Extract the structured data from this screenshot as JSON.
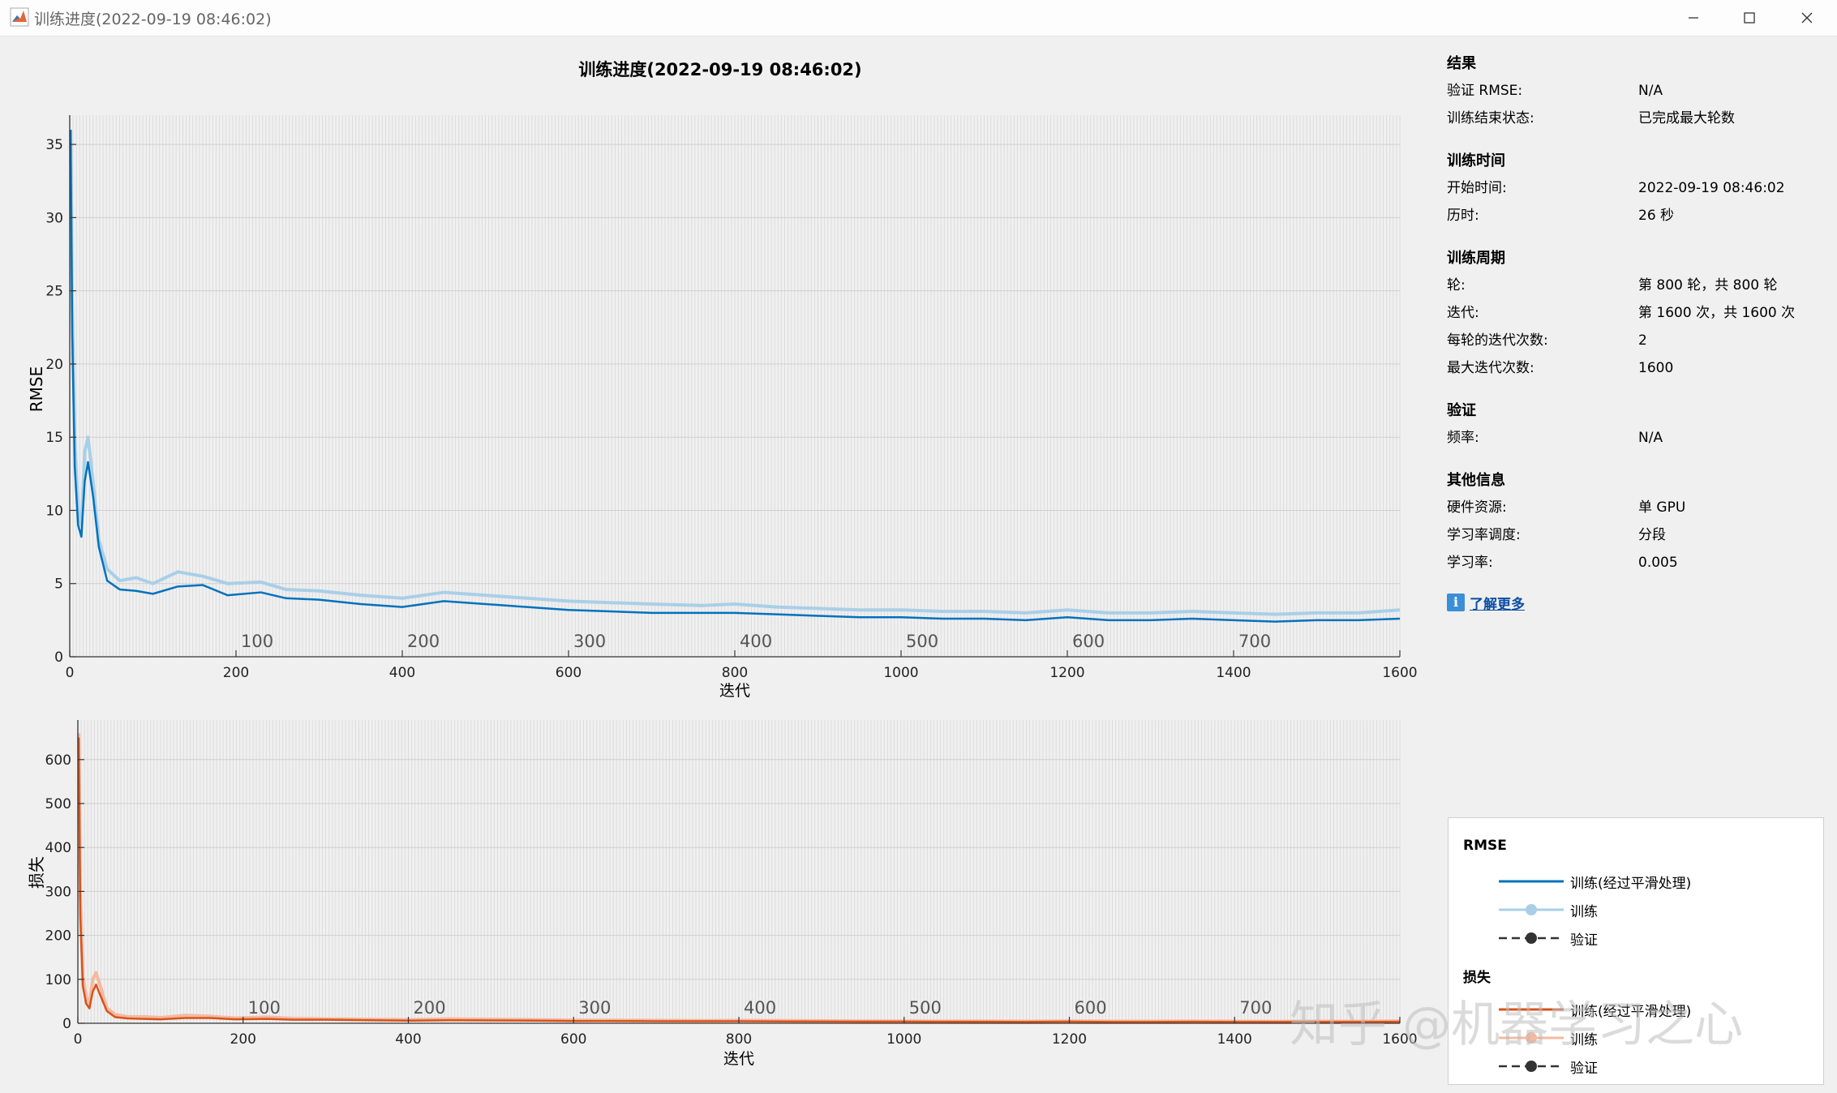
{
  "window": {
    "title": "训练进度(2022-09-19 08:46:02)"
  },
  "figure_title": "训练进度(2022-09-19 08:46:02)",
  "panel": {
    "results": {
      "heading": "结果",
      "rows": [
        {
          "k": "验证 RMSE:",
          "v": "N/A"
        },
        {
          "k": "训练结束状态:",
          "v": "已完成最大轮数"
        }
      ]
    },
    "time": {
      "heading": "训练时间",
      "rows": [
        {
          "k": "开始时间:",
          "v": "2022-09-19 08:46:02"
        },
        {
          "k": "历时:",
          "v": "26 秒"
        }
      ]
    },
    "cycle": {
      "heading": "训练周期",
      "rows": [
        {
          "k": "轮:",
          "v": "第 800 轮，共 800 轮"
        },
        {
          "k": "迭代:",
          "v": "第 1600 次，共 1600 次"
        },
        {
          "k": "每轮的迭代次数:",
          "v": "2"
        },
        {
          "k": "最大迭代次数:",
          "v": "1600"
        }
      ]
    },
    "validation": {
      "heading": "验证",
      "rows": [
        {
          "k": "频率:",
          "v": "N/A"
        }
      ]
    },
    "other": {
      "heading": "其他信息",
      "rows": [
        {
          "k": "硬件资源:",
          "v": "单 GPU"
        },
        {
          "k": "学习率调度:",
          "v": "分段"
        },
        {
          "k": "学习率:",
          "v": "0.005"
        }
      ]
    },
    "learn_more": "了解更多"
  },
  "legend": {
    "rmse_title": "RMSE",
    "rmse_items": [
      "训练(经过平滑处理)",
      "训练",
      "验证"
    ],
    "loss_title": "损失",
    "loss_items": [
      "训练(经过平滑处理)",
      "训练",
      "验证"
    ]
  },
  "colors": {
    "rmse_smoothed": "#0072bd",
    "rmse_raw": "#a9cfe8",
    "loss_smoothed": "#d95319",
    "loss_raw": "#f4b9a0",
    "validation": "#333333"
  },
  "watermark": "知乎 @机器学习之心",
  "chart_data": [
    {
      "type": "line",
      "ylabel": "RMSE",
      "xlabel": "迭代",
      "xlim": [
        0,
        1600
      ],
      "ylim": [
        0,
        37
      ],
      "xticks": [
        0,
        200,
        400,
        600,
        800,
        1000,
        1200,
        1400,
        1600
      ],
      "yticks": [
        0,
        5,
        10,
        15,
        20,
        25,
        30,
        35
      ],
      "epoch_labels": [
        100,
        200,
        300,
        400,
        500,
        600,
        700
      ],
      "grid": true,
      "series": [
        {
          "name": "训练(经过平滑处理)",
          "x": [
            1,
            3,
            6,
            10,
            14,
            18,
            22,
            28,
            35,
            45,
            60,
            80,
            100,
            130,
            160,
            190,
            230,
            260,
            300,
            350,
            400,
            450,
            500,
            550,
            600,
            650,
            700,
            760,
            800,
            850,
            900,
            950,
            1000,
            1050,
            1100,
            1150,
            1200,
            1250,
            1300,
            1350,
            1400,
            1450,
            1500,
            1550,
            1600
          ],
          "y": [
            36,
            22,
            13,
            9,
            8.2,
            12,
            13.3,
            11,
            7.5,
            5.2,
            4.6,
            4.5,
            4.3,
            4.8,
            4.9,
            4.2,
            4.4,
            4.0,
            3.9,
            3.6,
            3.4,
            3.8,
            3.6,
            3.4,
            3.2,
            3.1,
            3.0,
            3.0,
            3.0,
            2.9,
            2.8,
            2.7,
            2.7,
            2.6,
            2.6,
            2.5,
            2.7,
            2.5,
            2.5,
            2.6,
            2.5,
            2.4,
            2.5,
            2.5,
            2.6
          ]
        },
        {
          "name": "训练",
          "x": [
            1,
            3,
            6,
            10,
            14,
            18,
            22,
            28,
            35,
            45,
            60,
            80,
            100,
            130,
            160,
            190,
            230,
            260,
            300,
            350,
            400,
            450,
            500,
            550,
            600,
            650,
            700,
            760,
            800,
            850,
            900,
            950,
            1000,
            1050,
            1100,
            1150,
            1200,
            1250,
            1300,
            1350,
            1400,
            1450,
            1500,
            1550,
            1600
          ],
          "y": [
            36,
            24,
            15,
            10,
            9,
            14,
            15,
            12,
            8,
            6,
            5.2,
            5.4,
            5.0,
            5.8,
            5.5,
            5.0,
            5.1,
            4.6,
            4.5,
            4.2,
            4.0,
            4.4,
            4.2,
            4.0,
            3.8,
            3.7,
            3.6,
            3.5,
            3.6,
            3.4,
            3.3,
            3.2,
            3.2,
            3.1,
            3.1,
            3.0,
            3.2,
            3.0,
            3.0,
            3.1,
            3.0,
            2.9,
            3.0,
            3.0,
            3.2
          ]
        }
      ]
    },
    {
      "type": "line",
      "ylabel": "损失",
      "xlabel": "迭代",
      "xlim": [
        0,
        1600
      ],
      "ylim": [
        0,
        690
      ],
      "xticks": [
        0,
        200,
        400,
        600,
        800,
        1000,
        1200,
        1400,
        1600
      ],
      "yticks": [
        0,
        100,
        200,
        300,
        400,
        500,
        600
      ],
      "epoch_labels": [
        100,
        200,
        300,
        400,
        500,
        600,
        700
      ],
      "grid": true,
      "series": [
        {
          "name": "训练(经过平滑处理)",
          "x": [
            1,
            3,
            6,
            10,
            14,
            18,
            22,
            28,
            35,
            45,
            60,
            80,
            100,
            130,
            160,
            190,
            230,
            260,
            300,
            350,
            400,
            450,
            500,
            550,
            600,
            650,
            700,
            760,
            800,
            850,
            900,
            950,
            1000,
            1050,
            1100,
            1150,
            1200,
            1250,
            1300,
            1350,
            1400,
            1450,
            1500,
            1550,
            1600
          ],
          "y": [
            650,
            240,
            85,
            45,
            34,
            72,
            88,
            60,
            28,
            14,
            11,
            10,
            9,
            12,
            12,
            9,
            10,
            8,
            8,
            7,
            6,
            7,
            6.5,
            6,
            5,
            5,
            4.5,
            4.5,
            4.5,
            4.2,
            4,
            3.7,
            3.7,
            3.4,
            3.4,
            3.1,
            3.6,
            3.1,
            3.1,
            3.4,
            3.1,
            2.9,
            3.1,
            3.1,
            3.4
          ]
        },
        {
          "name": "训练",
          "x": [
            1,
            3,
            6,
            10,
            14,
            18,
            22,
            28,
            35,
            45,
            60,
            80,
            100,
            130,
            160,
            190,
            230,
            260,
            300,
            350,
            400,
            450,
            500,
            550,
            600,
            650,
            700,
            760,
            800,
            850,
            900,
            950,
            1000,
            1050,
            1100,
            1150,
            1200,
            1250,
            1300,
            1350,
            1400,
            1450,
            1500,
            1550,
            1600
          ],
          "y": [
            660,
            290,
            110,
            60,
            45,
            100,
            115,
            80,
            35,
            20,
            15,
            15,
            13,
            18,
            16,
            12,
            14,
            11,
            10,
            9,
            8,
            10,
            9,
            8,
            7,
            7,
            6.5,
            6,
            6.5,
            6,
            5.5,
            5,
            5,
            4.8,
            4.8,
            4.5,
            5,
            4.5,
            4.5,
            4.8,
            4.5,
            4.2,
            4.5,
            4.5,
            5
          ]
        }
      ]
    }
  ]
}
